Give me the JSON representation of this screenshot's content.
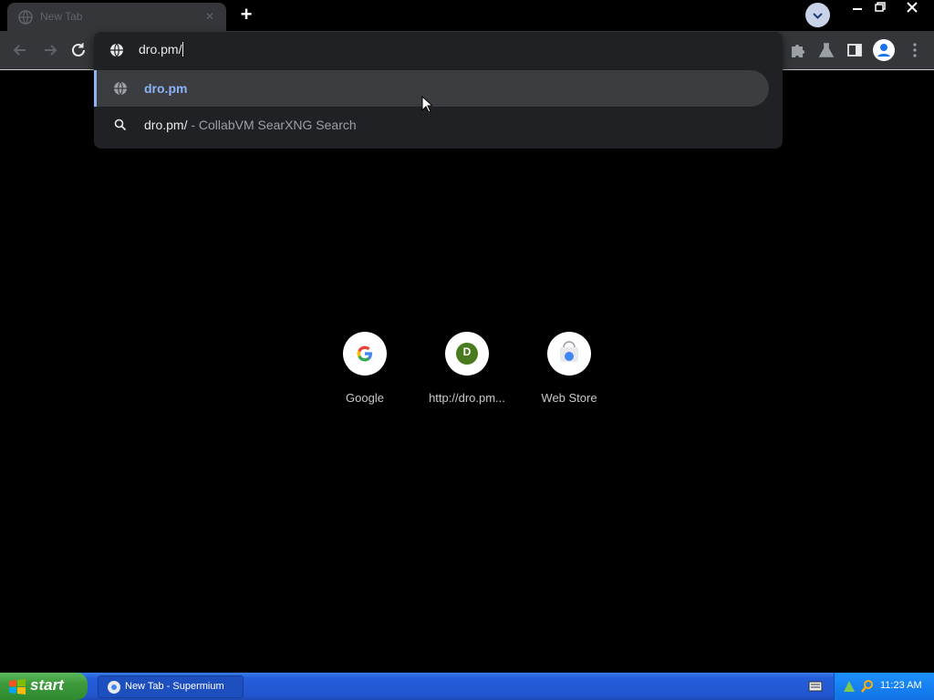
{
  "browser": {
    "tab_title": "New Tab",
    "tab_close_icon": "close-icon",
    "new_tab_label": "+",
    "window_controls": [
      "minimize",
      "restore",
      "close"
    ]
  },
  "omnibox": {
    "input_value": "dro.pm/",
    "suggestions": [
      {
        "text": "dro.pm",
        "description": "",
        "icon": "globe-icon",
        "kind": "url"
      },
      {
        "text": "dro.pm/",
        "description": "- CollabVM SearXNG Search",
        "icon": "search-icon",
        "kind": "search"
      }
    ]
  },
  "shortcuts": [
    {
      "label": "Google",
      "icon": "google-icon"
    },
    {
      "label": "http://dro.pm...",
      "icon": "letter-avatar-icon",
      "letter": "D"
    },
    {
      "label": "Web Store",
      "icon": "web-store-icon"
    }
  ],
  "taskbar": {
    "start_label": "start",
    "task_label": "New Tab - Supermium",
    "clock": "11:23 AM"
  },
  "colors": {
    "accent": "#8ab4f8",
    "toolbar_bg": "#35363a",
    "dropdown_bg": "#202124",
    "taskbar_blue": "#245edb",
    "start_green": "#3c9a3c"
  }
}
